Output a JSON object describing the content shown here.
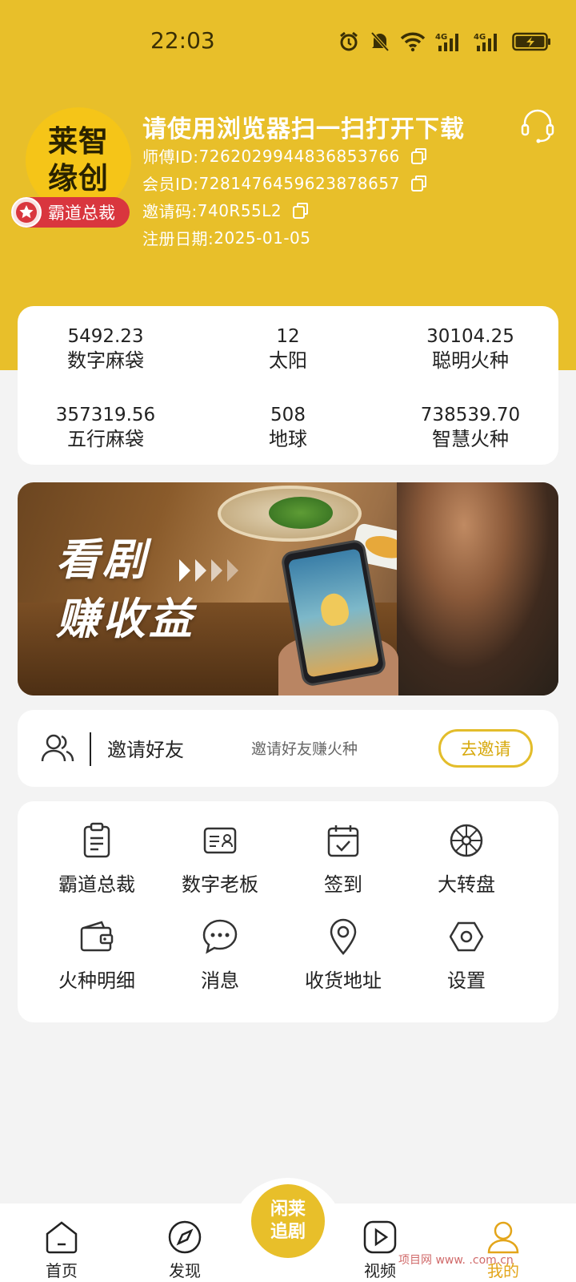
{
  "status_bar": {
    "time": "22:03"
  },
  "profile": {
    "avatar_text": "莱智缘创",
    "rank": "霸道总裁",
    "headline": "请使用浏览器扫一扫打开下载",
    "master_id_label": "师傅ID: ",
    "master_id": "7262029944836853766",
    "member_id_label": "会员ID: ",
    "member_id": "7281476459623878657",
    "invite_code_label": "邀请码: ",
    "invite_code": "740R55L2",
    "register_label": "注册日期: ",
    "register_date": "2025-01-05"
  },
  "stats": [
    {
      "value": "5492.23",
      "label": "数字麻袋"
    },
    {
      "value": "12",
      "label": "太阳"
    },
    {
      "value": "30104.25",
      "label": "聪明火种"
    },
    {
      "value": "357319.56",
      "label": "五行麻袋"
    },
    {
      "value": "508",
      "label": "地球"
    },
    {
      "value": "738539.70",
      "label": "智慧火种"
    }
  ],
  "banner": {
    "line1": "看剧",
    "line2": "赚收益"
  },
  "invite": {
    "title": "邀请好友",
    "subtitle": "邀请好友赚火种",
    "button": "去邀请"
  },
  "menu": [
    {
      "label": "霸道总裁",
      "icon": "clipboard-icon"
    },
    {
      "label": "数字老板",
      "icon": "id-card-icon"
    },
    {
      "label": "签到",
      "icon": "calendar-check-icon"
    },
    {
      "label": "大转盘",
      "icon": "wheel-icon"
    },
    {
      "label": "火种明细",
      "icon": "wallet-icon"
    },
    {
      "label": "消息",
      "icon": "chat-icon"
    },
    {
      "label": "收货地址",
      "icon": "location-icon"
    },
    {
      "label": "设置",
      "icon": "hexagon-settings-icon"
    }
  ],
  "nav": {
    "home": "首页",
    "discover": "发现",
    "center": "闲莱追剧",
    "video": "视频",
    "mine": "我的"
  },
  "colors": {
    "brand": "#e8bf2a",
    "badge": "#d9363e",
    "active": "#e3a51a"
  },
  "watermark": "项目网 www.  .com.cn"
}
